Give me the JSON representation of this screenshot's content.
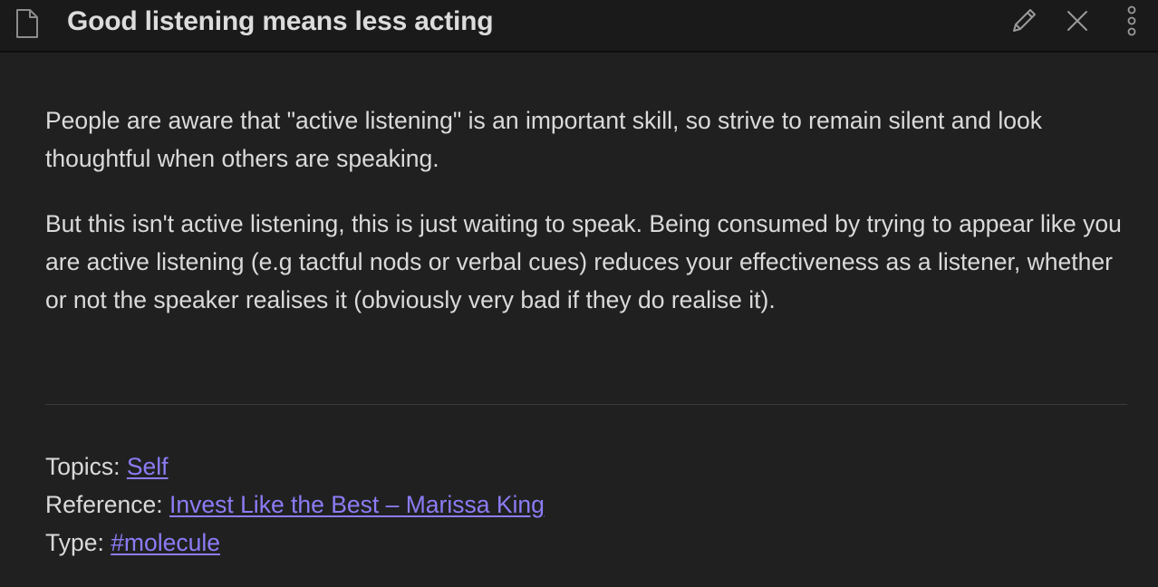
{
  "note": {
    "title": "Good listening means less acting",
    "paragraphs": [
      "People are aware that \"active listening\" is an important skill, so strive to remain silent and look thoughtful when others are speaking.",
      "But this isn't active listening, this is just waiting to speak. Being consumed by trying to appear like you are active listening (e.g tactful nods or verbal cues) reduces your effectiveness as a listener, whether or not the speaker realises it (obviously very bad if they do realise it)."
    ],
    "meta": {
      "topics_label": "Topics: ",
      "topics_link": "Self",
      "reference_label": "Reference: ",
      "reference_link": "Invest Like the Best – Marissa King",
      "type_label": "Type: ",
      "type_link": "#molecule"
    }
  },
  "toolbar": {
    "file_icon": "file-icon",
    "edit_icon": "pencil-icon",
    "close_icon": "close-icon",
    "more_icon": "more-options-icon"
  },
  "colors": {
    "background": "#202020",
    "titlebar": "#1a1a1a",
    "text": "#dadada",
    "link": "#8b7cf6"
  }
}
